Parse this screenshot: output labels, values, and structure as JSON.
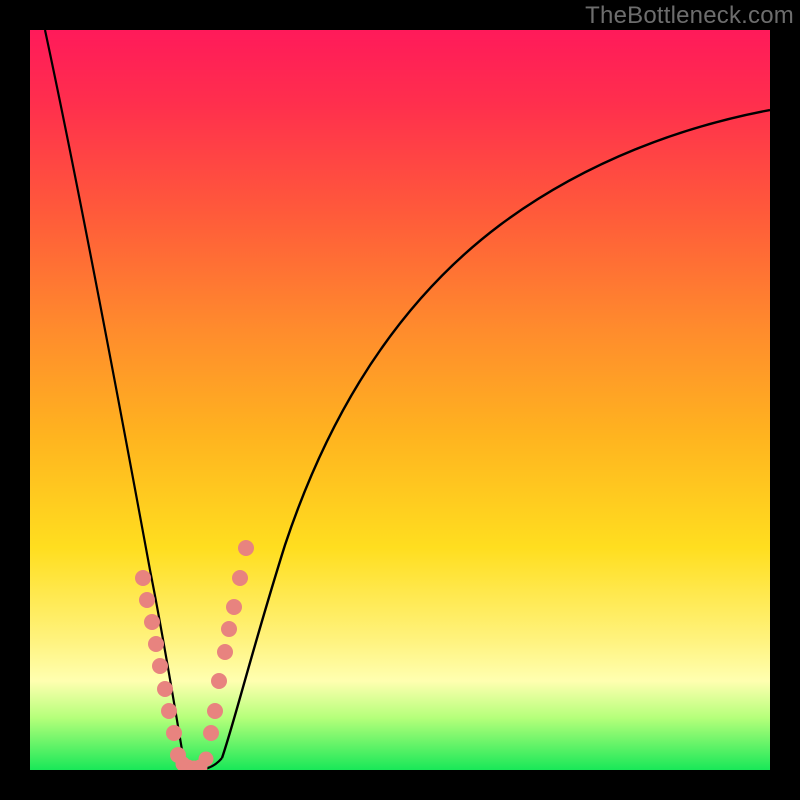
{
  "watermark": "TheBottleneck.com",
  "chart_data": {
    "type": "line",
    "title": "",
    "xlabel": "",
    "ylabel": "",
    "xlim": [
      0,
      100
    ],
    "ylim": [
      0,
      100
    ],
    "grid": false,
    "legend": false,
    "series": [
      {
        "name": "bottleneck-curve",
        "color": "#000000",
        "x": [
          2,
          4,
          6,
          8,
          10,
          12,
          14,
          16,
          18,
          19,
          20,
          21,
          22,
          24,
          26,
          28,
          30,
          33,
          38,
          45,
          55,
          65,
          75,
          85,
          95,
          100
        ],
        "y": [
          100,
          90,
          80,
          70,
          60,
          50,
          40,
          30,
          18,
          10,
          4,
          1,
          0.5,
          1,
          4,
          12,
          22,
          33,
          45,
          57,
          68,
          76,
          81,
          85,
          88,
          89
        ]
      }
    ],
    "markers": [
      {
        "name": "left-cluster",
        "color": "#e8837f",
        "x": [
          15.2,
          15.8,
          16.5,
          17.0,
          17.6,
          18.2,
          18.8,
          19.4,
          20.0
        ],
        "y": [
          26,
          23,
          20,
          17,
          14,
          11,
          8,
          5,
          2
        ]
      },
      {
        "name": "right-cluster",
        "color": "#e8837f",
        "x": [
          24.5,
          25.0,
          25.6,
          26.3,
          26.9,
          27.6,
          28.4,
          29.2
        ],
        "y": [
          5,
          8,
          12,
          16,
          19,
          22,
          26,
          30
        ]
      },
      {
        "name": "bottom-cluster",
        "color": "#e8837f",
        "x": [
          20.6,
          21.3,
          22.1,
          22.9,
          23.7
        ],
        "y": [
          0.8,
          0.4,
          0.3,
          0.5,
          1.5
        ]
      }
    ],
    "background_gradient": {
      "top": "#ff1a5a",
      "mid_upper": "#ff8a2d",
      "mid": "#ffde1f",
      "mid_lower": "#ffffb0",
      "bottom": "#18e858"
    }
  }
}
